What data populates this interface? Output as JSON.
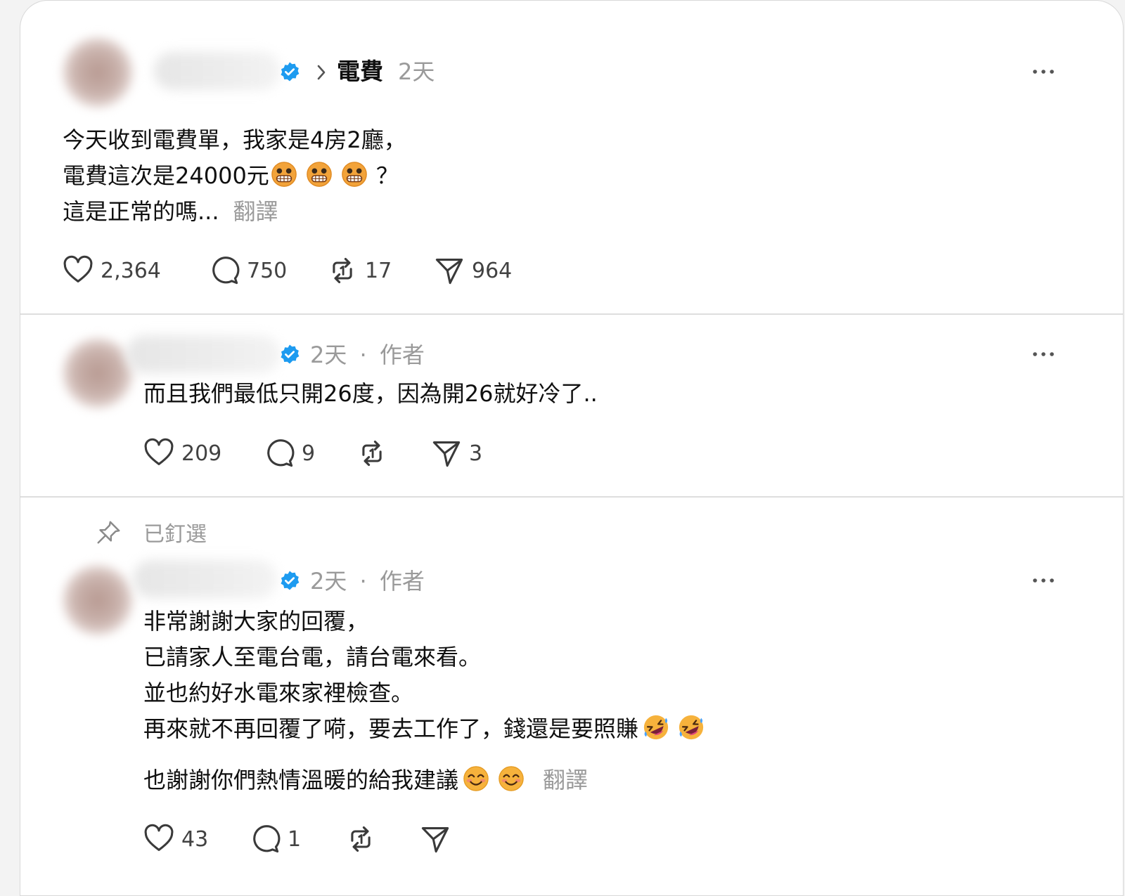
{
  "post": {
    "topic": "電費",
    "time": "2天",
    "lines": [
      "今天收到電費單，我家是4房2廳，",
      "電費這次是24000元",
      "？",
      "這是正常的嗎..."
    ],
    "translate": "翻譯",
    "likes": "2,364",
    "replies": "750",
    "reposts": "17",
    "shares": "964"
  },
  "reply1": {
    "time": "2天",
    "sep": "·",
    "role": "作者",
    "text": "而且我們最低只開26度，因為開26就好冷了..",
    "likes": "209",
    "replies": "9",
    "shares": "3"
  },
  "reply2": {
    "pinned": "已釘選",
    "time": "2天",
    "sep": "·",
    "role": "作者",
    "lines": [
      "非常謝謝大家的回覆，",
      "已請家人至電台電，請台電來看。",
      "並也約好水電來家裡檢查。",
      "再來就不再回覆了嗬，要去工作了，錢還是要照賺"
    ],
    "line5": "也謝謝你們熱情溫暖的給我建議",
    "translate": "翻譯",
    "likes": "43",
    "replies": "1"
  },
  "colors": {
    "verified": "#1d9bf0",
    "muted": "#9a9a9a",
    "divider": "#dedede"
  },
  "icons": [
    "verified-icon",
    "chevron-right-icon",
    "more-icon",
    "heart-icon",
    "comment-icon",
    "repost-icon",
    "share-icon",
    "pin-icon",
    "grimace-emoji",
    "rofl-emoji",
    "smile-emoji"
  ]
}
